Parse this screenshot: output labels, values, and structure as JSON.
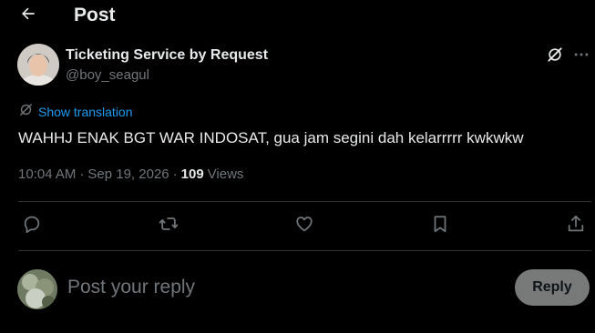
{
  "header": {
    "back_icon": "arrow-left-icon",
    "title": "Post"
  },
  "author": {
    "name": "Ticketing Service by Request",
    "handle": "@boy_seagul",
    "avatar_icon": "avatar-photo"
  },
  "top_actions": {
    "grok_icon": "grok-icon",
    "more_icon": "more-horizontal-icon"
  },
  "translation": {
    "label": "Show translation",
    "icon": "translate-icon"
  },
  "post": {
    "text": "WAHHJ ENAK BGT WAR INDOSAT, gua jam segini dah kelarrrrr kwkwkw"
  },
  "meta": {
    "time": "10:04 AM",
    "separator": "·",
    "date": "Sep 19, 2026",
    "views_count": "109",
    "views_label": "Views"
  },
  "actions": [
    {
      "name": "reply",
      "icon": "reply-icon"
    },
    {
      "name": "repost",
      "icon": "repost-icon"
    },
    {
      "name": "like",
      "icon": "heart-icon"
    },
    {
      "name": "bookmark",
      "icon": "bookmark-icon"
    },
    {
      "name": "share",
      "icon": "share-icon"
    }
  ],
  "reply": {
    "placeholder": "Post your reply",
    "button_label": "Reply"
  },
  "colors": {
    "background": "#000000",
    "text_primary": "#e7e9ea",
    "text_secondary": "#71767b",
    "accent": "#1d9bf0",
    "divider": "#2f3336",
    "reply_button_bg": "#787a7a"
  }
}
